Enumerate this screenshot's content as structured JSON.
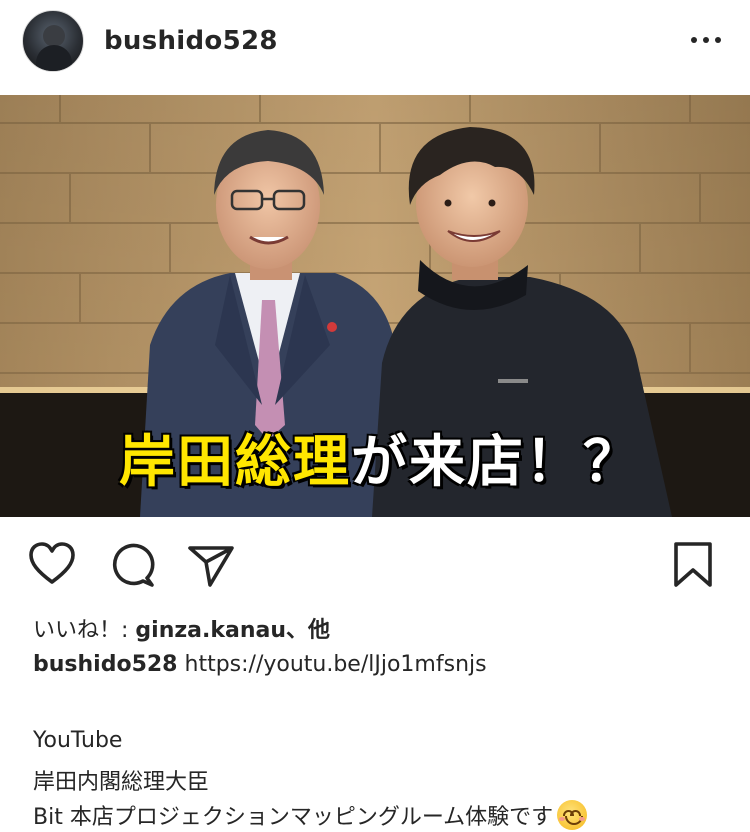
{
  "post": {
    "username": "bushido528",
    "overlay_text_yellow": "岸田総理",
    "overlay_text_white": "が来店！？"
  },
  "icons": {
    "avatar": "avatar",
    "more": "more-options-icon",
    "like": "heart-icon",
    "comment": "comment-icon",
    "share": "send-icon",
    "save": "bookmark-icon",
    "emoji": "smiling-face-emoji"
  },
  "likes": {
    "prefix": "いいね！: ",
    "user": "ginza.kanau",
    "suffix": "、他"
  },
  "caption": {
    "username": "bushido528",
    "link": "https://youtu.be/lJjo1mfsnjs"
  },
  "body_lines": [
    "YouTube",
    "岸田内閣総理大臣",
    "Bit 本店プロジェクションマッピングルーム体験です"
  ],
  "colors": {
    "overlay_yellow": "#ffe600",
    "text": "#262626"
  }
}
